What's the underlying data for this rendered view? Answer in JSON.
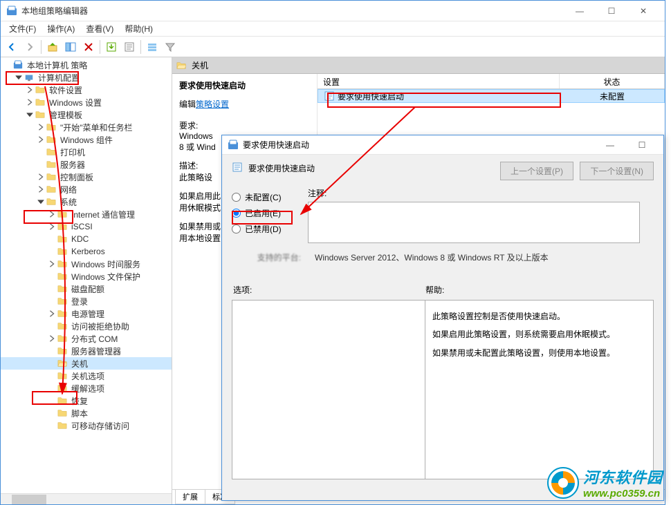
{
  "window": {
    "title": "本地组策略编辑器",
    "controls": {
      "min": "—",
      "max": "☐",
      "close": "✕"
    }
  },
  "menu": {
    "file": "文件(F)",
    "action": "操作(A)",
    "view": "查看(V)",
    "help": "帮助(H)"
  },
  "tree": {
    "root": "本地计算机 策略",
    "computer": "计算机配置",
    "software": "软件设置",
    "windows_settings": "Windows 设置",
    "admin_templates": "管理模板",
    "start_menu": "\"开始\"菜单和任务栏",
    "win_components": "Windows 组件",
    "printers": "打印机",
    "servers": "服务器",
    "control_panel": "控制面板",
    "network": "网络",
    "system": "系统",
    "internet_comm": "Internet 通信管理",
    "iscsi": "iSCSI",
    "kdc": "KDC",
    "kerberos": "Kerberos",
    "win_time": "Windows 时间服务",
    "win_file_protect": "Windows 文件保护",
    "disk_quota": "磁盘配额",
    "logon": "登录",
    "power_mgmt": "电源管理",
    "access_denied": "访问被拒绝协助",
    "dcom": "分布式 COM",
    "server_manager": "服务器管理器",
    "shutdown": "关机",
    "shutdown_options": "关机选项",
    "mitigation": "缓解选项",
    "recovery": "恢复",
    "scripts": "脚本",
    "removable_storage": "可移动存储访问"
  },
  "right": {
    "header": "关机",
    "policy_name": "要求使用快速启动",
    "edit_link_prefix": "编辑",
    "edit_link": "策略设置",
    "req_label": "要求:",
    "req_text1": "Windows",
    "req_text2": "8 或 Wind",
    "desc_label": "描述:",
    "desc_text": "此策略设",
    "desc_p1": "如果启用此",
    "desc_p2": "用休眠模式",
    "desc_p3": "如果禁用或",
    "desc_p4": "用本地设置",
    "col_setting": "设置",
    "col_state": "状态",
    "row_setting": "要求使用快速启动",
    "row_state": "未配置",
    "tab_extended": "扩展",
    "tab_standard": "标准"
  },
  "dialog": {
    "title": "要求使用快速启动",
    "subtitle": "要求使用快速启动",
    "prev": "上一个设置(P)",
    "next": "下一个设置(N)",
    "radio_unconfigured": "未配置(C)",
    "radio_enabled": "已启用(E)",
    "radio_disabled": "已禁用(D)",
    "comment_label": "注释:",
    "platform_label": "支持的平台:",
    "platform_text": "Windows Server 2012、Windows 8 或 Windows RT 及以上版本",
    "options_label": "选项:",
    "help_label": "帮助:",
    "help_p1": "此策略设置控制是否使用快速启动。",
    "help_p2": "如果启用此策略设置，则系统需要启用休眠模式。",
    "help_p3": "如果禁用或未配置此策略设置，则使用本地设置。"
  },
  "watermark": {
    "name": "河东软件园",
    "url": "www.pc0359.cn"
  }
}
